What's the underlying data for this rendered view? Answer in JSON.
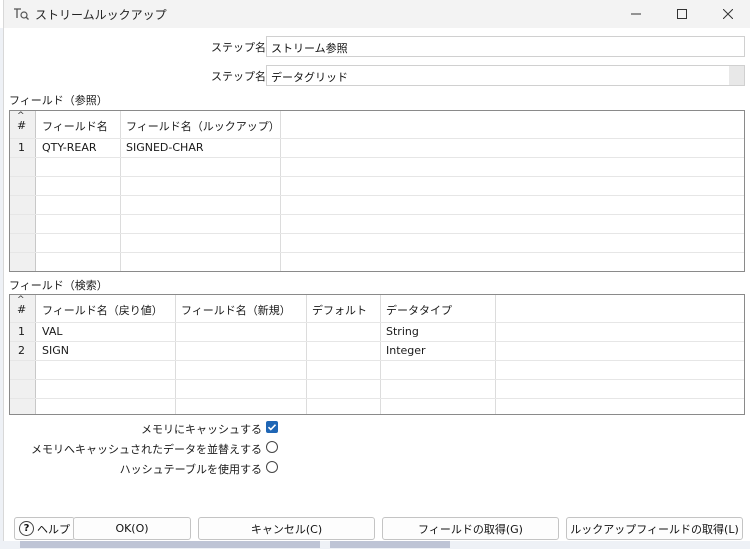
{
  "window": {
    "title": "ストリームルックアップ"
  },
  "step": {
    "name_label": "ステップ名",
    "name_value": "ストリーム参照",
    "source_label": "ステップ名",
    "source_value": "データグリッド"
  },
  "reference_fields": {
    "section_label": "フィールド（参照）",
    "columns": [
      "#",
      "フィールド名",
      "フィールド名（ルックアップ）"
    ],
    "rows": [
      {
        "num": "1",
        "field": "QTY-REAR",
        "lookup": "SIGNED-CHAR"
      }
    ]
  },
  "retrieve_fields": {
    "section_label": "フィールド（検索）",
    "columns": [
      "#",
      "フィールド名（戻り値）",
      "フィールド名（新規）",
      "デフォルト",
      "データタイプ"
    ],
    "rows": [
      {
        "num": "1",
        "field": "VAL",
        "new_name": "",
        "default": "",
        "type": "String"
      },
      {
        "num": "2",
        "field": "SIGN",
        "new_name": "",
        "default": "",
        "type": "Integer"
      }
    ]
  },
  "options": {
    "cache_in_memory": {
      "label": "メモリにキャッシュする",
      "checked": true
    },
    "sort_cached_data": {
      "label": "メモリへキャッシュされたデータを並替えする",
      "checked": false
    },
    "use_hashtable": {
      "label": "ハッシュテーブルを使用する",
      "checked": false
    }
  },
  "buttons": {
    "help": "ヘルプ",
    "ok": "OK(O)",
    "cancel": "キャンセル(C)",
    "get_fields": "フィールドの取得(G)",
    "get_lookup_fields": "ルックアップフィールドの取得(L)"
  },
  "colors": {
    "checkbox_accent": "#1f66b5",
    "titlebar_bg": "#f3f3f3"
  }
}
